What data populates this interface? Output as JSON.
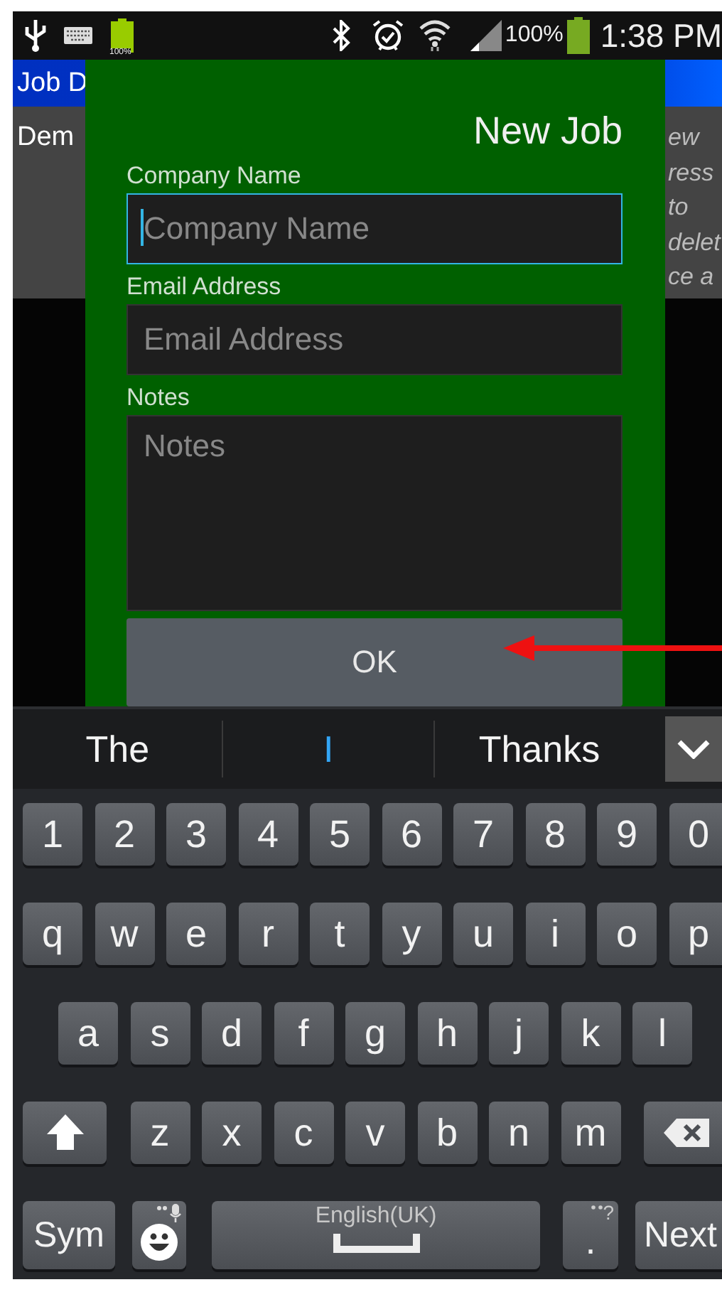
{
  "status_bar": {
    "battery_badge": "100%",
    "battery_percent": "100%",
    "time": "1:38 PM"
  },
  "app": {
    "title": "Job D",
    "list_item": "Dem",
    "side_note_lines": [
      "ew",
      "ress",
      "to",
      "delet",
      "ce a"
    ]
  },
  "dialog": {
    "title": "New Job",
    "fields": [
      {
        "label": "Company Name",
        "placeholder": "Company Name",
        "kind": "line",
        "focused": true
      },
      {
        "label": "Email Address",
        "placeholder": "Email Address",
        "kind": "line",
        "focused": false
      },
      {
        "label": "Notes",
        "placeholder": "Notes",
        "kind": "multiline",
        "focused": false
      }
    ],
    "ok_button": "OK"
  },
  "suggestions": [
    {
      "text": "The",
      "highlighted": false
    },
    {
      "text": "I",
      "highlighted": true
    },
    {
      "text": "Thanks",
      "highlighted": false
    }
  ],
  "keyboard": {
    "rows": [
      {
        "keys": [
          {
            "kind": "char",
            "label": "1"
          },
          {
            "kind": "char",
            "label": "2"
          },
          {
            "kind": "char",
            "label": "3"
          },
          {
            "kind": "char",
            "label": "4"
          },
          {
            "kind": "char",
            "label": "5"
          },
          {
            "kind": "char",
            "label": "6"
          },
          {
            "kind": "char",
            "label": "7"
          },
          {
            "kind": "char",
            "label": "8"
          },
          {
            "kind": "char",
            "label": "9"
          },
          {
            "kind": "char",
            "label": "0"
          }
        ]
      },
      {
        "keys": [
          {
            "kind": "char",
            "label": "q"
          },
          {
            "kind": "char",
            "label": "w"
          },
          {
            "kind": "char",
            "label": "e"
          },
          {
            "kind": "char",
            "label": "r"
          },
          {
            "kind": "char",
            "label": "t"
          },
          {
            "kind": "char",
            "label": "y"
          },
          {
            "kind": "char",
            "label": "u"
          },
          {
            "kind": "char",
            "label": "i"
          },
          {
            "kind": "char",
            "label": "o"
          },
          {
            "kind": "char",
            "label": "p"
          }
        ]
      },
      {
        "keys": [
          {
            "kind": "char",
            "label": "a"
          },
          {
            "kind": "char",
            "label": "s"
          },
          {
            "kind": "char",
            "label": "d"
          },
          {
            "kind": "char",
            "label": "f"
          },
          {
            "kind": "char",
            "label": "g"
          },
          {
            "kind": "char",
            "label": "h"
          },
          {
            "kind": "char",
            "label": "j"
          },
          {
            "kind": "char",
            "label": "k"
          },
          {
            "kind": "char",
            "label": "l"
          }
        ]
      },
      {
        "keys": [
          {
            "kind": "shift"
          },
          {
            "kind": "char",
            "label": "z"
          },
          {
            "kind": "char",
            "label": "x"
          },
          {
            "kind": "char",
            "label": "c"
          },
          {
            "kind": "char",
            "label": "v"
          },
          {
            "kind": "char",
            "label": "b"
          },
          {
            "kind": "char",
            "label": "n"
          },
          {
            "kind": "char",
            "label": "m"
          },
          {
            "kind": "delete"
          }
        ]
      },
      {
        "keys": [
          {
            "kind": "sym",
            "label": "Sym"
          },
          {
            "kind": "emoji"
          },
          {
            "kind": "space",
            "label": "English(UK)"
          },
          {
            "kind": "dot",
            "label": ".",
            "hint": "?"
          },
          {
            "kind": "next",
            "label": "Next"
          }
        ]
      }
    ]
  }
}
